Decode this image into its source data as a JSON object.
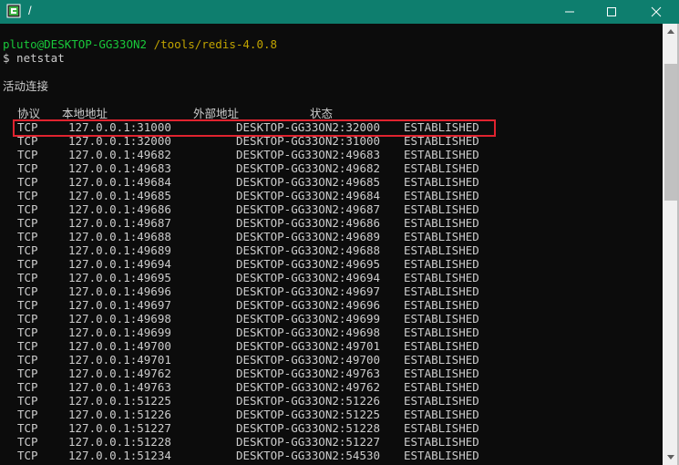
{
  "window": {
    "title": "/"
  },
  "prompt": {
    "user_host": "pluto@DESKTOP-GG33ON2",
    "path": "/tools/redis-4.0.8",
    "command_line": "$ netstat"
  },
  "section_title": "活动连接",
  "headers": {
    "proto": "协议",
    "local": "本地地址",
    "foreign": "外部地址",
    "state": "状态"
  },
  "connections": [
    [
      "TCP",
      "127.0.0.1:31000",
      "DESKTOP-GG33ON2:32000",
      "ESTABLISHED"
    ],
    [
      "TCP",
      "127.0.0.1:32000",
      "DESKTOP-GG33ON2:31000",
      "ESTABLISHED"
    ],
    [
      "TCP",
      "127.0.0.1:49682",
      "DESKTOP-GG33ON2:49683",
      "ESTABLISHED"
    ],
    [
      "TCP",
      "127.0.0.1:49683",
      "DESKTOP-GG33ON2:49682",
      "ESTABLISHED"
    ],
    [
      "TCP",
      "127.0.0.1:49684",
      "DESKTOP-GG33ON2:49685",
      "ESTABLISHED"
    ],
    [
      "TCP",
      "127.0.0.1:49685",
      "DESKTOP-GG33ON2:49684",
      "ESTABLISHED"
    ],
    [
      "TCP",
      "127.0.0.1:49686",
      "DESKTOP-GG33ON2:49687",
      "ESTABLISHED"
    ],
    [
      "TCP",
      "127.0.0.1:49687",
      "DESKTOP-GG33ON2:49686",
      "ESTABLISHED"
    ],
    [
      "TCP",
      "127.0.0.1:49688",
      "DESKTOP-GG33ON2:49689",
      "ESTABLISHED"
    ],
    [
      "TCP",
      "127.0.0.1:49689",
      "DESKTOP-GG33ON2:49688",
      "ESTABLISHED"
    ],
    [
      "TCP",
      "127.0.0.1:49694",
      "DESKTOP-GG33ON2:49695",
      "ESTABLISHED"
    ],
    [
      "TCP",
      "127.0.0.1:49695",
      "DESKTOP-GG33ON2:49694",
      "ESTABLISHED"
    ],
    [
      "TCP",
      "127.0.0.1:49696",
      "DESKTOP-GG33ON2:49697",
      "ESTABLISHED"
    ],
    [
      "TCP",
      "127.0.0.1:49697",
      "DESKTOP-GG33ON2:49696",
      "ESTABLISHED"
    ],
    [
      "TCP",
      "127.0.0.1:49698",
      "DESKTOP-GG33ON2:49699",
      "ESTABLISHED"
    ],
    [
      "TCP",
      "127.0.0.1:49699",
      "DESKTOP-GG33ON2:49698",
      "ESTABLISHED"
    ],
    [
      "TCP",
      "127.0.0.1:49700",
      "DESKTOP-GG33ON2:49701",
      "ESTABLISHED"
    ],
    [
      "TCP",
      "127.0.0.1:49701",
      "DESKTOP-GG33ON2:49700",
      "ESTABLISHED"
    ],
    [
      "TCP",
      "127.0.0.1:49762",
      "DESKTOP-GG33ON2:49763",
      "ESTABLISHED"
    ],
    [
      "TCP",
      "127.0.0.1:49763",
      "DESKTOP-GG33ON2:49762",
      "ESTABLISHED"
    ],
    [
      "TCP",
      "127.0.0.1:51225",
      "DESKTOP-GG33ON2:51226",
      "ESTABLISHED"
    ],
    [
      "TCP",
      "127.0.0.1:51226",
      "DESKTOP-GG33ON2:51225",
      "ESTABLISHED"
    ],
    [
      "TCP",
      "127.0.0.1:51227",
      "DESKTOP-GG33ON2:51228",
      "ESTABLISHED"
    ],
    [
      "TCP",
      "127.0.0.1:51228",
      "DESKTOP-GG33ON2:51227",
      "ESTABLISHED"
    ],
    [
      "TCP",
      "127.0.0.1:51234",
      "DESKTOP-GG33ON2:54530",
      "ESTABLISHED"
    ]
  ],
  "highlighted_row": 0,
  "colors": {
    "titlebar": "#0e7e6e",
    "prompt_user": "#19c83a",
    "prompt_path": "#c0a300",
    "highlight_box": "#e0232f"
  }
}
